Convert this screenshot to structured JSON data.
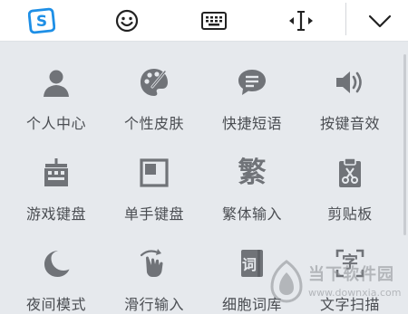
{
  "toolbar": {
    "items": [
      {
        "icon": "sogou-logo-icon",
        "label": "S"
      },
      {
        "icon": "emoji-icon"
      },
      {
        "icon": "keyboard-icon"
      },
      {
        "icon": "cursor-move-icon"
      },
      {
        "icon": "chevron-down-icon"
      }
    ]
  },
  "colors": {
    "brand_blue": "#1e8fe6",
    "icon_gray": "#707378",
    "label_gray": "#4a4d52",
    "panel_bg": "#e6e9ed"
  },
  "grid": {
    "items": [
      {
        "label": "个人中心",
        "icon": "user-icon"
      },
      {
        "label": "个性皮肤",
        "icon": "palette-icon"
      },
      {
        "label": "快捷短语",
        "icon": "chat-bubble-icon"
      },
      {
        "label": "按键音效",
        "icon": "speaker-icon"
      },
      {
        "label": "游戏键盘",
        "icon": "game-keyboard-icon"
      },
      {
        "label": "单手键盘",
        "icon": "one-hand-keyboard-icon"
      },
      {
        "label": "繁体输入",
        "icon": "traditional-chinese-icon",
        "glyph": "繁"
      },
      {
        "label": "剪贴板",
        "icon": "clipboard-icon"
      },
      {
        "label": "夜间模式",
        "icon": "moon-icon"
      },
      {
        "label": "滑行输入",
        "icon": "swipe-hand-icon"
      },
      {
        "label": "细胞词库",
        "icon": "dictionary-icon",
        "glyph": "词"
      },
      {
        "label": "文字扫描",
        "icon": "text-scan-icon",
        "glyph": "字"
      }
    ]
  },
  "watermark": {
    "cn": "当下软件园",
    "en": "www.downxia.com"
  }
}
